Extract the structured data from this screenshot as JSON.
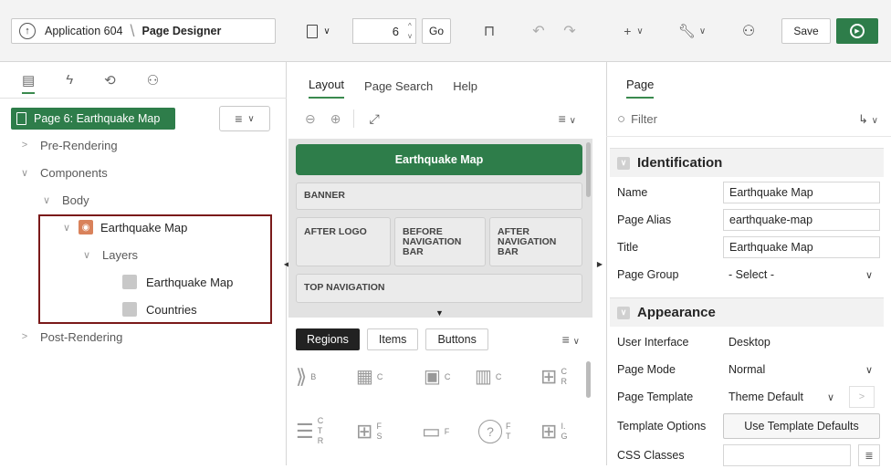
{
  "toolbar": {
    "app_label": "Application 604",
    "page_designer_label": "Page Designer",
    "page_number": "6",
    "go_label": "Go",
    "save_label": "Save"
  },
  "left": {
    "tabs": [
      "tree-icon",
      "lightning-icon",
      "loop-icon",
      "share-icon"
    ],
    "page_chip": "Page 6: Earthquake Map",
    "tree": [
      {
        "label": "Pre-Rendering"
      },
      {
        "label": "Components"
      },
      {
        "label": "Body"
      },
      {
        "label": "Earthquake Map"
      },
      {
        "label": "Layers"
      },
      {
        "label": "Earthquake Map"
      },
      {
        "label": "Countries"
      },
      {
        "label": "Post-Rendering"
      }
    ]
  },
  "middle": {
    "tabs": [
      "Layout",
      "Page Search",
      "Help"
    ],
    "page_title_bar": "Earthquake Map",
    "positions": {
      "banner": "BANNER",
      "after_logo": "AFTER LOGO",
      "before_nav": "BEFORE\nNAVIGATION\nBAR",
      "after_nav": "AFTER\nNAVIGATION\nBAR",
      "top_nav": "TOP NAVIGATION"
    },
    "gallery_tabs": [
      "Regions",
      "Items",
      "Buttons"
    ],
    "gallery_letters": [
      "B",
      "C",
      "C",
      "C",
      "C\nR",
      "C\nT\nR",
      "F\nS",
      "F",
      "F\nT",
      "I.\nG"
    ]
  },
  "right": {
    "tab": "Page",
    "filter_placeholder": "Filter",
    "groups": {
      "identification": "Identification",
      "appearance": "Appearance"
    },
    "props": {
      "name_label": "Name",
      "name_value": "Earthquake Map",
      "alias_label": "Page Alias",
      "alias_value": "earthquake-map",
      "title_label": "Title",
      "title_value": "Earthquake Map",
      "group_label": "Page Group",
      "group_value": "- Select -",
      "ui_label": "User Interface",
      "ui_value": "Desktop",
      "mode_label": "Page Mode",
      "mode_value": "Normal",
      "template_label": "Page Template",
      "template_value": "Theme Default",
      "options_label": "Template Options",
      "options_button": "Use Template Defaults",
      "css_label": "CSS Classes"
    }
  },
  "colors": {
    "accent": "#2e7d4a",
    "highlight_border": "#7a1a1a",
    "run_button": "#2e7d4a"
  }
}
